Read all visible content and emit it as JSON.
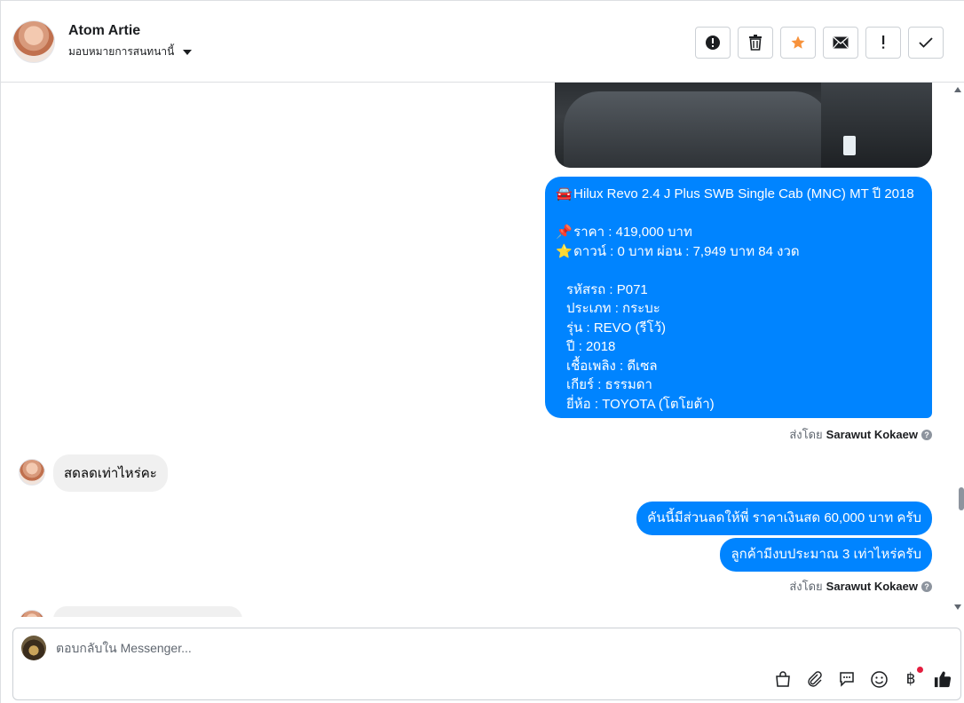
{
  "header": {
    "contact_name": "Atom Artie",
    "assign_label": "มอบหมายการสนทนานี้",
    "actions": [
      {
        "name": "report-spam-button",
        "icon": "alert-circle-icon"
      },
      {
        "name": "delete-button",
        "icon": "trash-icon"
      },
      {
        "name": "star-button",
        "icon": "star-icon",
        "color": "#f7923b"
      },
      {
        "name": "mark-unread-button",
        "icon": "envelope-icon"
      },
      {
        "name": "priority-button",
        "icon": "exclamation-icon"
      },
      {
        "name": "mark-done-button",
        "icon": "check-icon"
      }
    ]
  },
  "thread": {
    "listing": {
      "title": "Hilux Revo 2.4 J Plus SWB Single Cab (MNC) MT ปี 2018",
      "price": "ราคา : 419,000 บาท",
      "down": "ดาวน์ : 0 บาท ผ่อน : 7,949 บาท 84 งวด",
      "code": "รหัสรถ : P071",
      "type": "ประเภท : กระบะ",
      "model": "รุ่น : REVO (รีโว้)",
      "year": "ปี : 2018",
      "fuel": "เชื้อเพลิง : ดีเซล",
      "gear": "เกียร์ : ธรรมดา",
      "brand": "ยี่ห้อ : TOYOTA (โตโยต้า)"
    },
    "sent_by_label": "ส่งโดย",
    "sent_by_name": "Sarawut Kokaew",
    "incoming_1": "สดลดเท่าไหร่คะ",
    "outgoing_1": "คันนี้มีส่วนลดให้พี่ ราคาเงินสด 60,000 บาท ครับ",
    "outgoing_2": "ลูกค้ามีงบประมาณ 3 เท่าไหร่ครับ"
  },
  "composer": {
    "placeholder": "ตอบกลับใน Messenger...",
    "tools": [
      "shopping-bag-icon",
      "paperclip-icon",
      "saved-reply-icon",
      "emoji-icon",
      "baht-payment-icon",
      "thumbs-up-icon"
    ]
  },
  "colors": {
    "accent": "#0084ff",
    "incoming_bubble": "#f0f0f0",
    "star": "#f7923b",
    "notification_dot": "#e41e3f"
  }
}
